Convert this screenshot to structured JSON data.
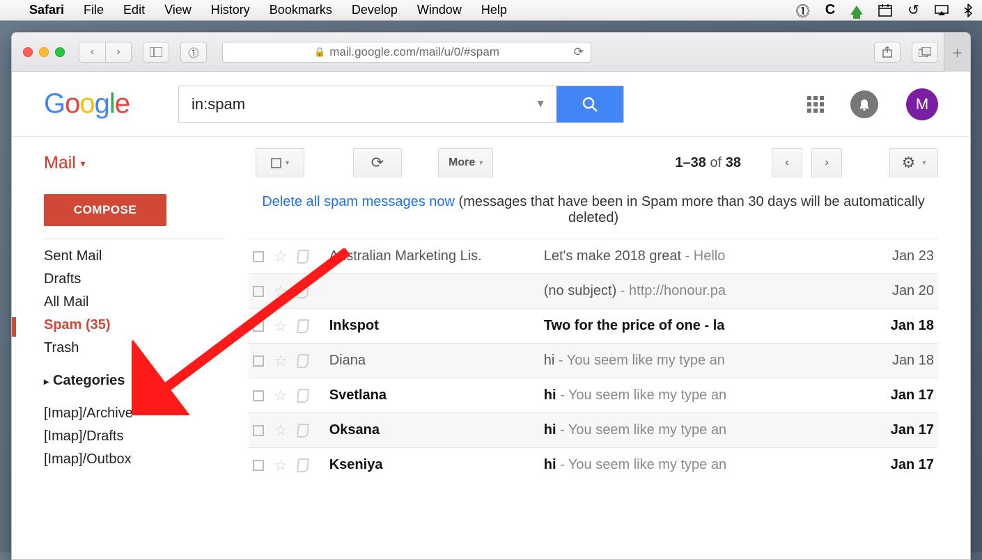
{
  "menubar": {
    "app": "Safari",
    "items": [
      "File",
      "Edit",
      "View",
      "History",
      "Bookmarks",
      "Develop",
      "Window",
      "Help"
    ]
  },
  "browser": {
    "url": "mail.google.com/mail/u/0/#spam"
  },
  "google_logo": [
    "G",
    "o",
    "o",
    "g",
    "l",
    "e"
  ],
  "search": {
    "value": "in:spam"
  },
  "avatar_initial": "M",
  "mail_label": "Mail",
  "toolbar": {
    "more": "More",
    "range": "1–38",
    "of": "of",
    "total": "38"
  },
  "sidebar": {
    "compose": "COMPOSE",
    "items": [
      {
        "label": "Sent Mail",
        "bold": false
      },
      {
        "label": "Drafts",
        "bold": false
      },
      {
        "label": "All Mail",
        "bold": false
      },
      {
        "label": "Spam (35)",
        "spam": true
      },
      {
        "label": "Trash",
        "bold": false
      },
      {
        "label": "Categories",
        "bold": true,
        "cat": true
      },
      {
        "label": "[Imap]/Archive",
        "bold": false
      },
      {
        "label": "[Imap]/Drafts",
        "bold": false
      },
      {
        "label": "[Imap]/Outbox",
        "bold": false
      }
    ]
  },
  "notice": {
    "link": "Delete all spam messages now",
    "rest": " (messages that have been in Spam more than 30 days will be automatically deleted)"
  },
  "emails": [
    {
      "from": "Australian Marketing Lis.",
      "subject": "Let's make 2018 great",
      "preview": " - Hello",
      "date": "Jan 23",
      "unread": false
    },
    {
      "from": "",
      "subject": "(no subject)",
      "preview": " - http://honour.pa",
      "date": "Jan 20",
      "unread": false
    },
    {
      "from": "Inkspot",
      "subject": "Two for the price of one - la",
      "preview": "",
      "date": "Jan 18",
      "unread": true
    },
    {
      "from": "Diana",
      "subject": "hi",
      "preview": " - You seem like my type an",
      "date": "Jan 18",
      "unread": false
    },
    {
      "from": "Svetlana",
      "subject": "hi",
      "preview": " - You seem like my type an",
      "date": "Jan 17",
      "unread": true
    },
    {
      "from": "Oksana",
      "subject": "hi",
      "preview": " - You seem like my type an",
      "date": "Jan 17",
      "unread": true
    },
    {
      "from": "Kseniya",
      "subject": "hi",
      "preview": " - You seem like my type an",
      "date": "Jan 17",
      "unread": true
    }
  ]
}
